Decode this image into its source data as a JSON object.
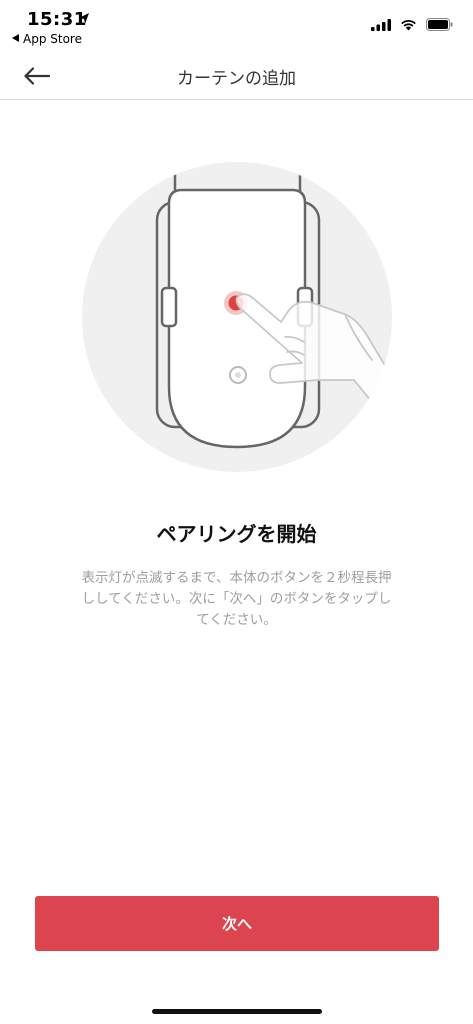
{
  "status_bar": {
    "time": "15:31",
    "back_app": "App Store",
    "icons": [
      "location-icon",
      "signal-icon",
      "wifi-icon",
      "battery-icon"
    ]
  },
  "nav": {
    "title": "カーテンの追加",
    "back_icon": "arrow-left-icon"
  },
  "illustration": {
    "icons": [
      "curtain-device-icon",
      "pointing-hand-icon"
    ],
    "colors": {
      "circle_bg": "#f0f0f0",
      "device_outline": "#666666",
      "led": "#e04040"
    }
  },
  "main": {
    "heading": "ペアリングを開始",
    "description_lines": [
      "表示灯が点滅するまで、本体のボタンを２秒程長押",
      "ししてください。次に「次へ」のボタンをタップし",
      "てください。"
    ]
  },
  "footer": {
    "next_label": "次へ",
    "accent_color": "#dc4450"
  }
}
